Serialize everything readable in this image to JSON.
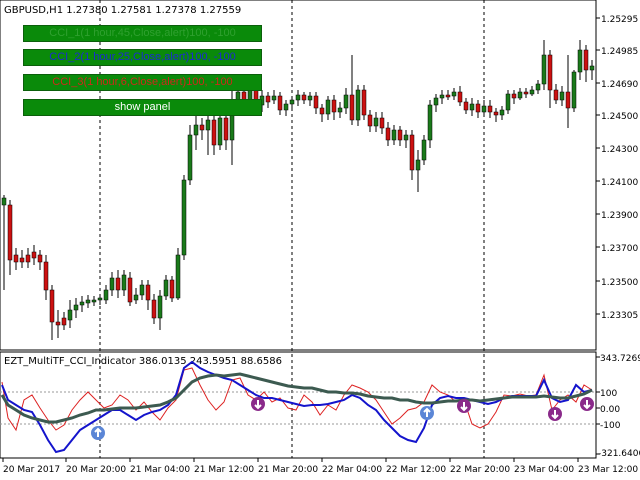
{
  "main_chart": {
    "header": "GBPUSD,H1  1.27380 1.27581 1.27378 1.27559",
    "price_labels": [
      "1.25295",
      "1.24985",
      "1.24690",
      "1.24500",
      "1.24300",
      "1.24100",
      "1.23900",
      "1.23700",
      "1.23500",
      "1.23305"
    ]
  },
  "indicator": {
    "header": "EZT_MultiTF_CCI_Indicator 386.0135 243.5951 88.6586",
    "scale_labels": [
      "343.7269",
      "100",
      "0.00",
      "-100",
      "-321.6406"
    ]
  },
  "time_axis": [
    "20 Mar 2017",
    "20 Mar 20:00",
    "21 Mar 04:00",
    "21 Mar 12:00",
    "21 Mar 20:00",
    "22 Mar 04:00",
    "22 Mar 12:00",
    "22 Mar 20:00",
    "23 Mar 04:00",
    "23 Mar 12:00"
  ],
  "panel_buttons": [
    {
      "label": "CCI_1(1 hour,45,Close,alert)100, -100",
      "color": "#0a8a0a",
      "text_color": "#2b9b2b"
    },
    {
      "label": "CCI_2(1 hour,25,Close,alert)100, -100",
      "color": "#0a8a0a",
      "text_color": "#1c2bd1"
    },
    {
      "label": "CCI_3(1 hour,6,Close,alert)100, -100",
      "color": "#0a8a0a",
      "text_color": "#cc2a1a"
    },
    {
      "label": "show panel",
      "color": "#0a8a0a",
      "text_color": "#ffffff"
    }
  ],
  "colors": {
    "bull_candle": "#1a7a1a",
    "bear_candle": "#cc1111",
    "cci_slow": "#3c5a50",
    "cci_mid": "#1414cc",
    "cci_fast": "#dd2222",
    "arrow_up": "#5b86d6",
    "arrow_down": "#8a2a8a"
  }
}
